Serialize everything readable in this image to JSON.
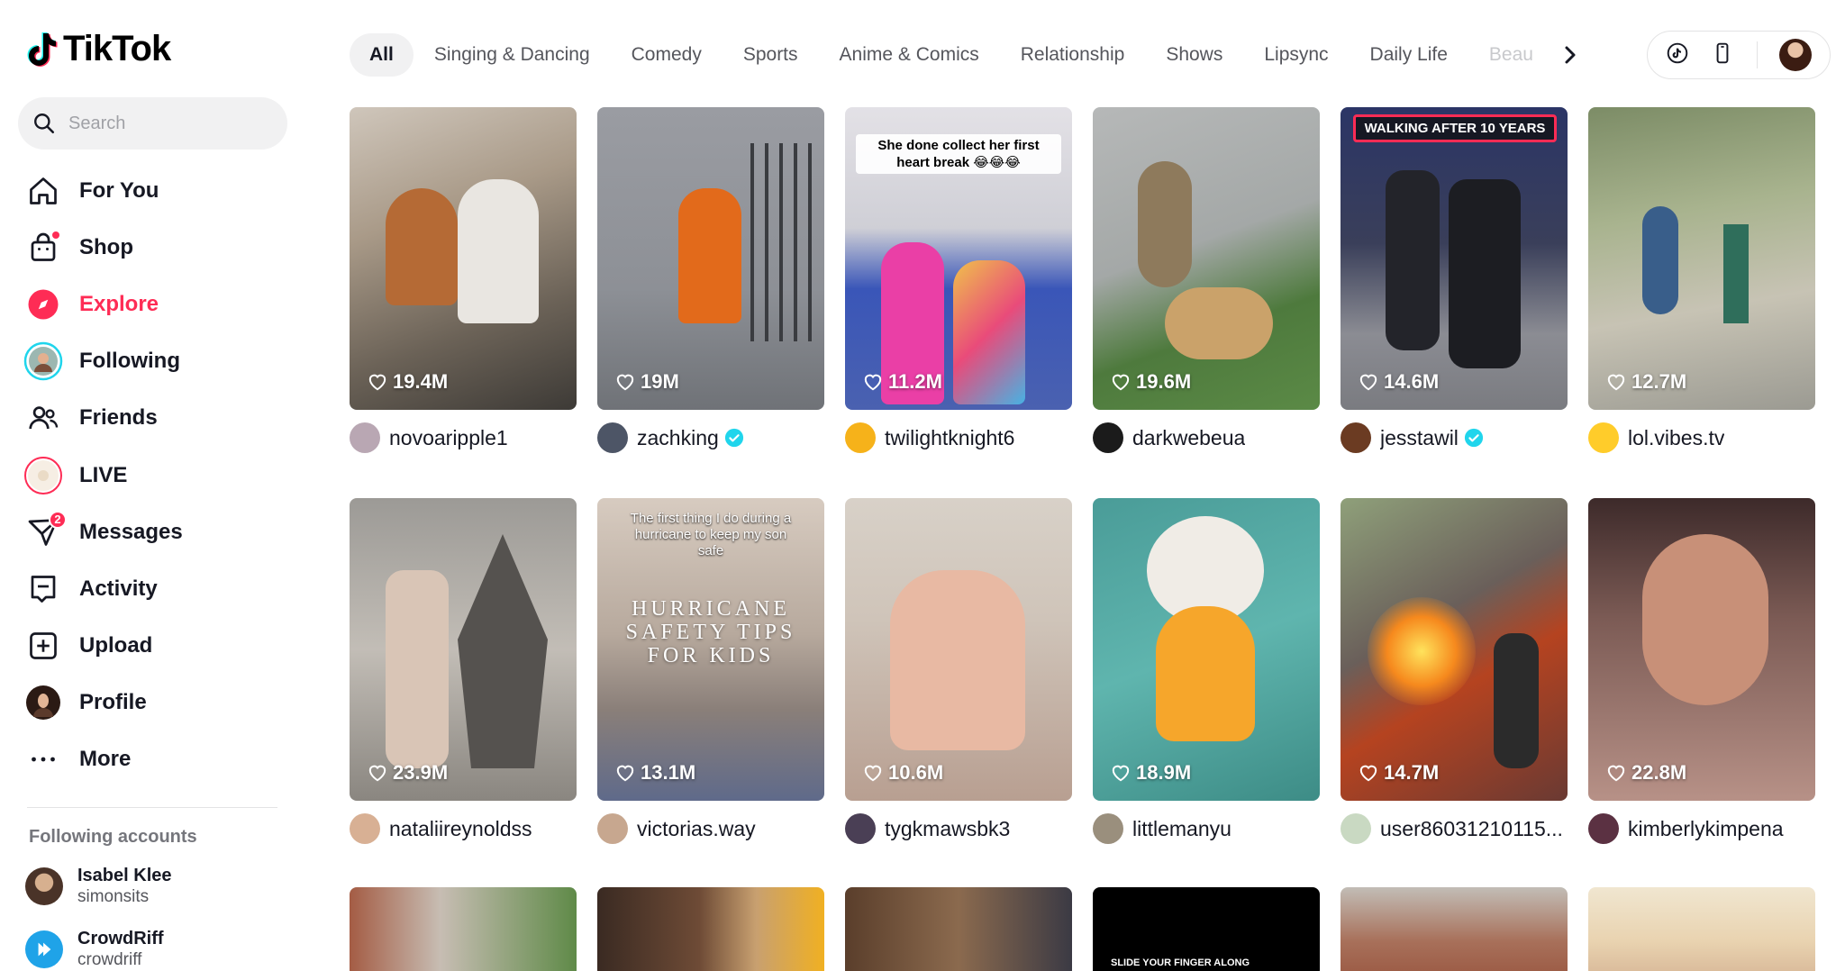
{
  "brand": {
    "name": "TikTok"
  },
  "search": {
    "placeholder": "Search"
  },
  "nav": [
    {
      "label": "For You",
      "icon": "home-icon"
    },
    {
      "label": "Shop",
      "icon": "shopping-bag-icon"
    },
    {
      "label": "Explore",
      "icon": "compass-icon",
      "active": true
    },
    {
      "label": "Following",
      "icon": "following-avatar-icon"
    },
    {
      "label": "Friends",
      "icon": "friends-icon"
    },
    {
      "label": "LIVE",
      "icon": "live-icon"
    },
    {
      "label": "Messages",
      "icon": "messages-icon",
      "badge": "2"
    },
    {
      "label": "Activity",
      "icon": "activity-icon"
    },
    {
      "label": "Upload",
      "icon": "upload-icon"
    },
    {
      "label": "Profile",
      "icon": "profile-avatar-icon"
    },
    {
      "label": "More",
      "icon": "more-icon"
    }
  ],
  "following_accounts": {
    "title": "Following accounts",
    "items": [
      {
        "name": "Isabel Klee",
        "handle": "simonsits"
      },
      {
        "name": "CrowdRiff",
        "handle": "crowdriff"
      }
    ]
  },
  "categories": [
    "All",
    "Singing & Dancing",
    "Comedy",
    "Sports",
    "Anime & Comics",
    "Relationship",
    "Shows",
    "Lipsync",
    "Daily Life",
    "Beau"
  ],
  "videos": [
    {
      "likes": "19.4M",
      "user": "novoaripple1",
      "verified": false
    },
    {
      "likes": "19M",
      "user": "zachking",
      "verified": true
    },
    {
      "likes": "11.2M",
      "user": "twilightknight6",
      "verified": false,
      "caption": "She done collect her first heart break 😂😂😂"
    },
    {
      "likes": "19.6M",
      "user": "darkwebeua",
      "verified": false
    },
    {
      "likes": "14.6M",
      "user": "jesstawil",
      "verified": true,
      "caption": "WALKING AFTER 10 YEARS"
    },
    {
      "likes": "12.7M",
      "user": "lol.vibes.tv",
      "verified": false
    },
    {
      "likes": "23.9M",
      "user": "nataliireynoldss",
      "verified": false
    },
    {
      "likes": "13.1M",
      "user": "victorias.way",
      "verified": false,
      "caption": "The first thing I do during a hurricane to keep my son safe",
      "overlay": "HURRICANE SAFETY TIPS FOR KIDS"
    },
    {
      "likes": "10.6M",
      "user": "tygkmawsbk3",
      "verified": false
    },
    {
      "likes": "18.9M",
      "user": "littlemanyu",
      "verified": false
    },
    {
      "likes": "14.7M",
      "user": "user86031210115...",
      "verified": false
    },
    {
      "likes": "22.8M",
      "user": "kimberlykimpena",
      "verified": false
    }
  ],
  "partial_row": [
    {
      "text": ""
    },
    {
      "text": ""
    },
    {
      "text": ""
    },
    {
      "text": "SLIDE YOUR FINGER ALONG"
    },
    {
      "text": ""
    },
    {
      "text": ""
    }
  ],
  "colors": {
    "accent": "#fe2c55",
    "verified": "#20d5ec"
  }
}
